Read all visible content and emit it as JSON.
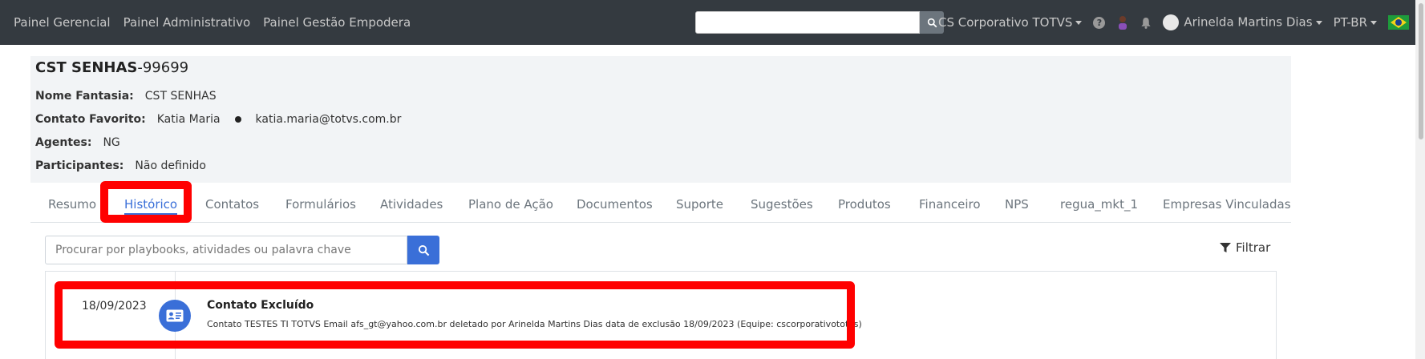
{
  "navbar": {
    "links": [
      "Painel Gerencial",
      "Painel Administrativo",
      "Painel Gestão Empodera"
    ],
    "search_value": "",
    "workspace": "CS Corporativo TOTVS",
    "user_name": "Arinelda Martins Dias",
    "language": "PT-BR",
    "help_glyph": "?"
  },
  "account": {
    "name": "CST SENHAS",
    "id_suffix": "-99699",
    "nome_fantasia_label": "Nome Fantasia:",
    "nome_fantasia": "CST SENHAS",
    "contato_label": "Contato Favorito:",
    "contato_nome": "Katia Maria",
    "contato_email": "katia.maria@totvs.com.br",
    "agentes_label": "Agentes:",
    "agentes": "NG",
    "participantes_label": "Participantes:",
    "participantes": "Não definido"
  },
  "tabs": [
    {
      "label": "Resumo",
      "active": false
    },
    {
      "label": "Histórico",
      "active": true
    },
    {
      "label": "Contatos",
      "active": false
    },
    {
      "label": "Formulários",
      "active": false
    },
    {
      "label": "Atividades",
      "active": false
    },
    {
      "label": "Plano de Ação",
      "active": false
    },
    {
      "label": "Documentos",
      "active": false
    },
    {
      "label": "Suporte",
      "active": false
    },
    {
      "label": "Sugestões",
      "active": false
    },
    {
      "label": "Produtos",
      "active": false
    },
    {
      "label": "Financeiro",
      "active": false
    },
    {
      "label": "NPS",
      "active": false
    },
    {
      "label": "regua_mkt_1",
      "active": false
    },
    {
      "label": "Empresas Vinculadas",
      "active": false
    }
  ],
  "history": {
    "search_placeholder": "Procurar por playbooks, atividades ou palavra chave",
    "filter_label": "Filtrar",
    "entries": [
      {
        "date": "18/09/2023",
        "title": "Contato Excluído",
        "description": "Contato TESTES TI TOTVS Email afs_gt@yahoo.com.br deletado por Arinelda Martins Dias data de exclusão 18/09/2023 (Equipe: cscorporativototvs)",
        "icon": "contact-card-icon"
      }
    ]
  },
  "colors": {
    "navbar_bg": "#343a40",
    "accent": "#3a6fd8",
    "highlight": "#ff0000",
    "panel_bg": "#f2f4f6"
  }
}
